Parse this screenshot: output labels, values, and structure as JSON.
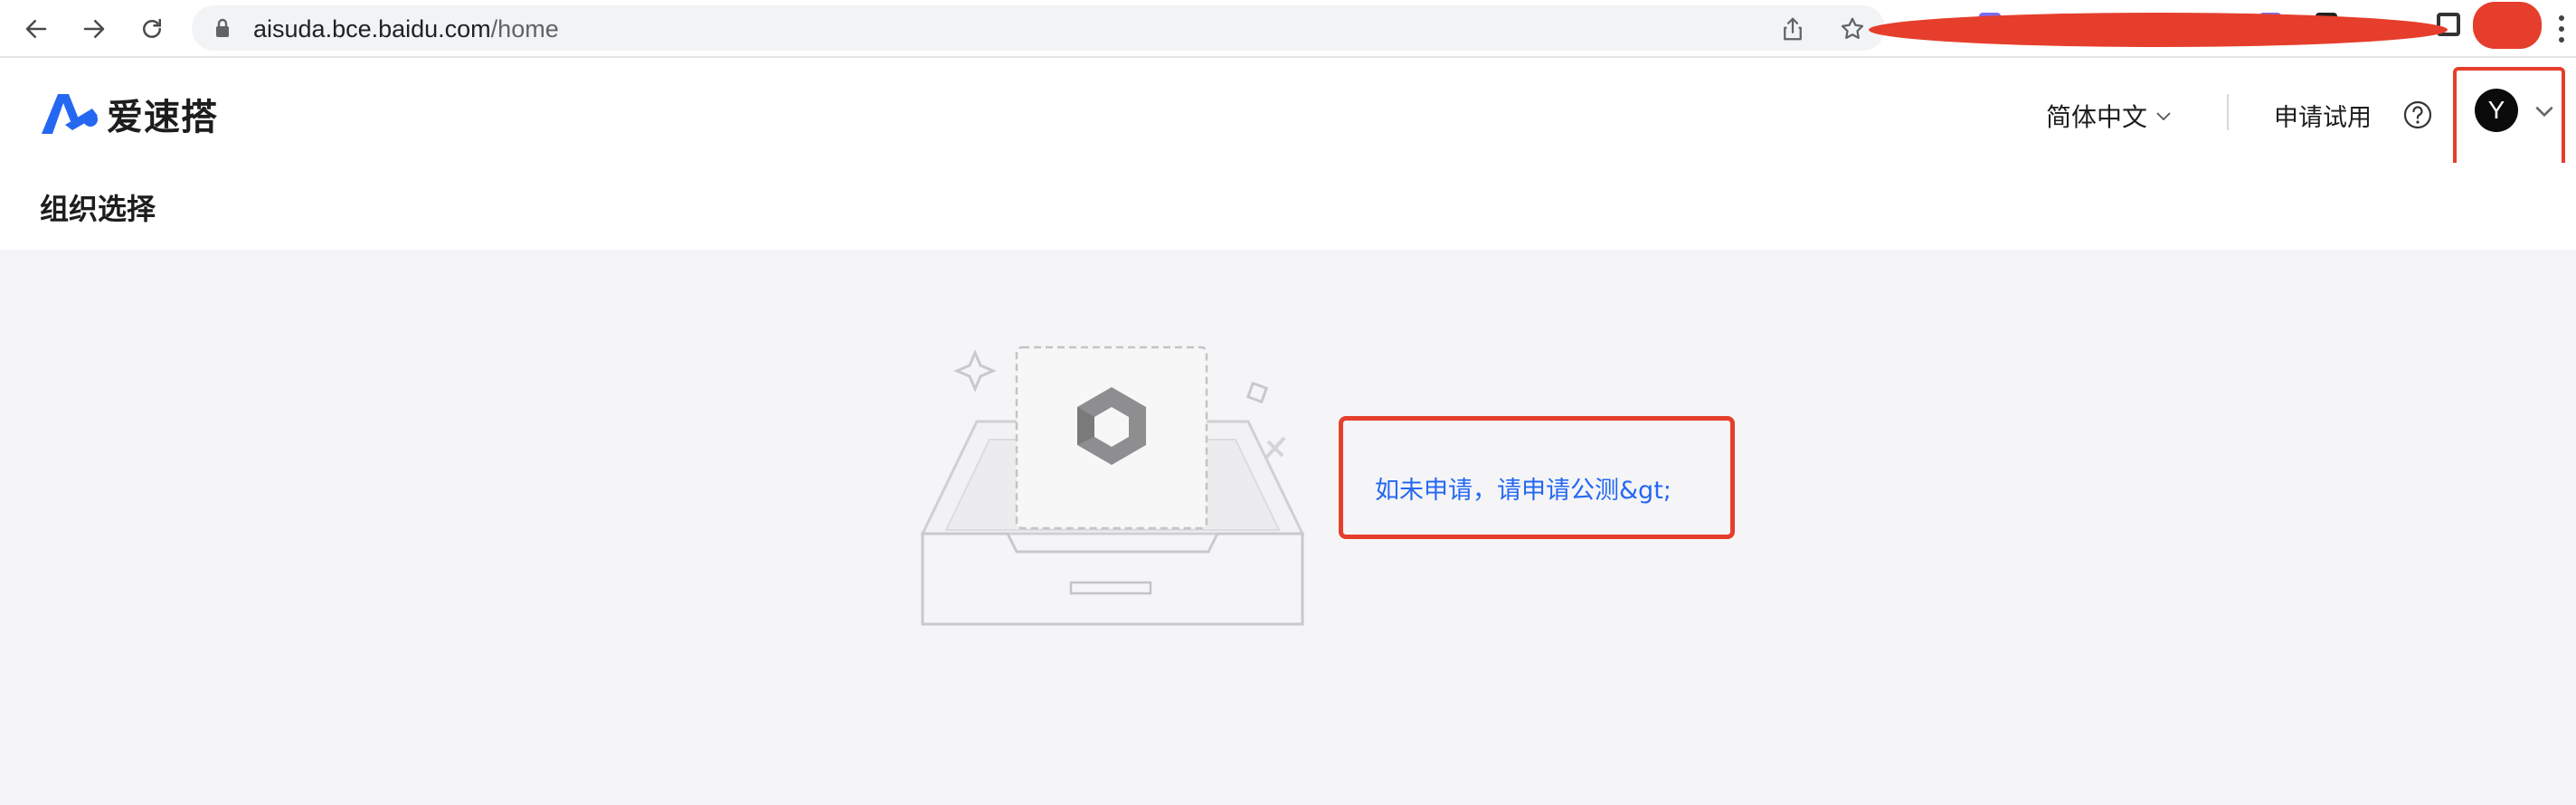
{
  "browser": {
    "url_host": "aisuda.bce.baidu.com",
    "url_path": "/home",
    "icons": [
      "back-arrow-icon",
      "forward-arrow-icon",
      "reload-icon",
      "lock-icon",
      "share-icon",
      "star-icon"
    ]
  },
  "header": {
    "logo_text": "爱速搭",
    "language_label": "简体中文",
    "apply_trial_label": "申请试用",
    "avatar_initial": "Y"
  },
  "page": {
    "title": "组织选择"
  },
  "empty_state": {
    "link_text": "如未申请，请申请公测&gt;"
  },
  "colors": {
    "link": "#2468f2",
    "highlight": "#e63e2c",
    "brand": "#2468f2"
  }
}
